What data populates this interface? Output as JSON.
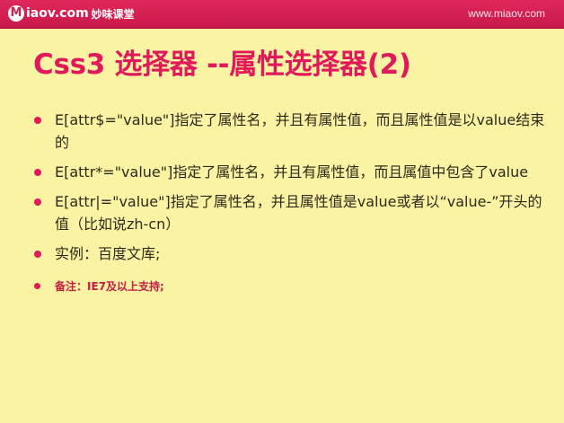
{
  "header": {
    "logo_letter": "M",
    "logo_text": "iaov.com",
    "logo_cn": "妙味课堂",
    "site_url": "www.miaov.com"
  },
  "slide": {
    "title": "Css3 选择器 --属性选择器(2)",
    "bullets": [
      {
        "text": "E[attr$=\"value\"]指定了属性名，并且有属性值，而且属性值是以value结束的"
      },
      {
        "text": "E[attr*=\"value\"]指定了属性名，并且有属性值，而且属值中包含了value"
      },
      {
        "text": "E[attr|=\"value\"]指定了属性名，并且属性值是value或者以“value-”开头的值（比如说zh-cn）"
      },
      {
        "text": "实例：百度文库;"
      }
    ],
    "note": "备注：IE7及以上支持;"
  },
  "colors": {
    "accent": "#e01a5a",
    "background": "#fbf3a4",
    "header": "#d21f52"
  }
}
